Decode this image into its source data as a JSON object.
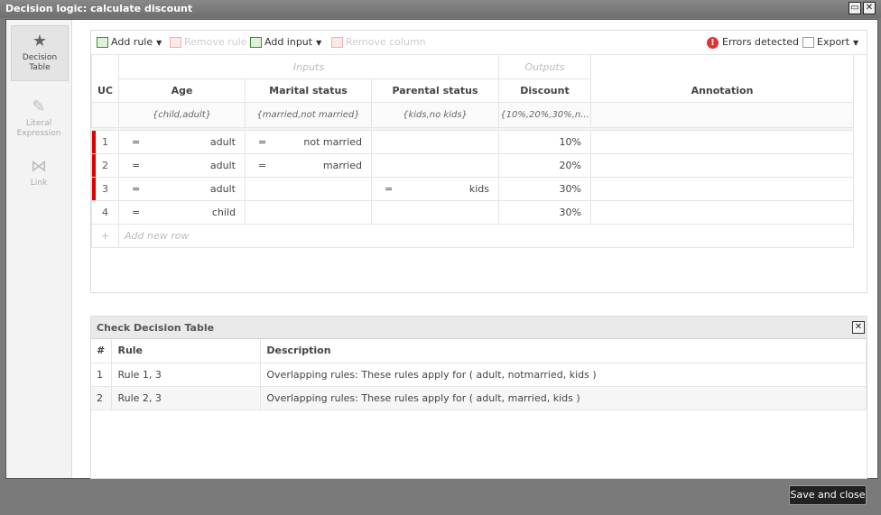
{
  "window": {
    "title": "Decision logic: calculate discount"
  },
  "nav": [
    {
      "label": "Decision Table",
      "icon": "star-icon",
      "active": true
    },
    {
      "label": "Literal Expression",
      "icon": "pencil-icon",
      "active": false
    },
    {
      "label": "Link",
      "icon": "link-icon",
      "active": false
    }
  ],
  "toolbar": {
    "add_rule": "Add rule",
    "remove_rule": "Remove rule",
    "add_input": "Add input",
    "remove_column": "Remove column",
    "errors": "Errors detected",
    "export": "Export"
  },
  "table": {
    "group_inputs": "Inputs",
    "group_outputs": "Outputs",
    "headers": [
      "UC",
      "Age",
      "Marital status",
      "Parental status",
      "Discount",
      "Annotation"
    ],
    "allowed": [
      "",
      "{child,adult}",
      "{married,not married}",
      "{kids,no kids}",
      "{10%,20%,30%,n...",
      ""
    ],
    "rows": [
      {
        "num": "1",
        "age_op": "=",
        "age": "adult",
        "marital_op": "=",
        "marital": "not married",
        "parental_op": "",
        "parental": "",
        "discount": "10%",
        "annotation": "",
        "error": true
      },
      {
        "num": "2",
        "age_op": "=",
        "age": "adult",
        "marital_op": "=",
        "marital": "married",
        "parental_op": "",
        "parental": "",
        "discount": "20%",
        "annotation": "",
        "error": true
      },
      {
        "num": "3",
        "age_op": "=",
        "age": "adult",
        "marital_op": "",
        "marital": "",
        "parental_op": "=",
        "parental": "kids",
        "discount": "30%",
        "annotation": "",
        "error": true
      },
      {
        "num": "4",
        "age_op": "=",
        "age": "child",
        "marital_op": "",
        "marital": "",
        "parental_op": "",
        "parental": "",
        "discount": "30%",
        "annotation": "",
        "error": false
      }
    ],
    "add_row": "Add new row"
  },
  "check": {
    "title": "Check Decision Table",
    "headers": [
      "#",
      "Rule",
      "Description"
    ],
    "rows": [
      {
        "num": "1",
        "rule": "Rule 1, 3",
        "description": "Overlapping rules: These rules apply for ( adult, notmarried, kids )"
      },
      {
        "num": "2",
        "rule": "Rule 2, 3",
        "description": "Overlapping rules: These rules apply for ( adult, married, kids )"
      }
    ]
  },
  "footer": {
    "save_close": "Save and close"
  }
}
